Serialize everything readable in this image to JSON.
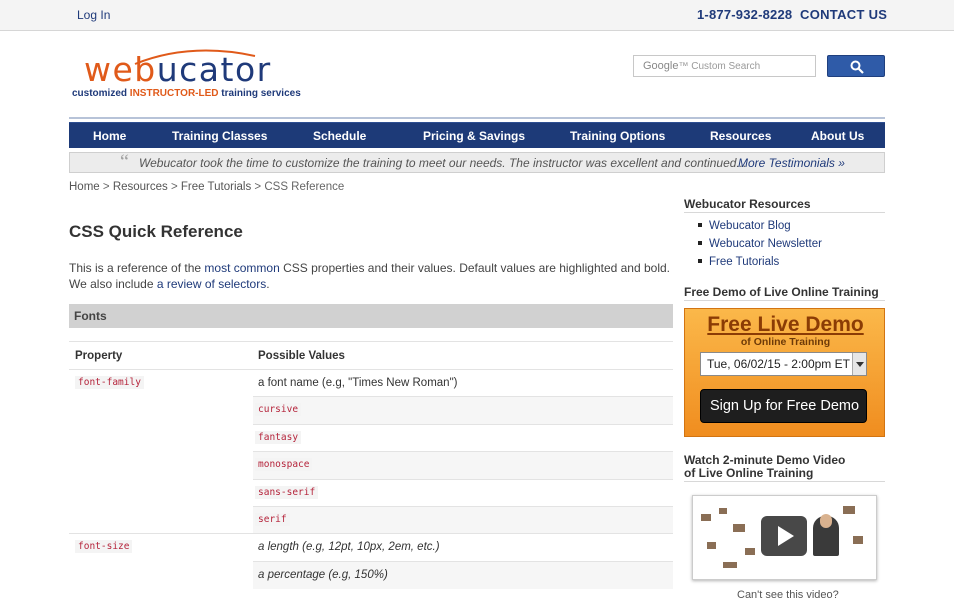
{
  "topbar": {
    "login": "Log In",
    "phone": "1-877-932-8228",
    "contact": "CONTACT US"
  },
  "logo": {
    "word_web": "web",
    "word_ucator": "ucator",
    "tagline_pre": "customized",
    "tagline_ilt": "INSTRUCTOR-LED",
    "tagline_post": "training services"
  },
  "search": {
    "placeholder_brand": "Google",
    "placeholder": "Custom Search"
  },
  "nav": {
    "items": [
      "Home",
      "Training Classes",
      "Schedule",
      "Pricing & Savings",
      "Training Options",
      "Resources",
      "About Us"
    ]
  },
  "testimonial": {
    "quote_mark": "“",
    "text": "Webucator took the time to customize the training to meet our needs. The instructor was excellent and continued...",
    "more": "More Testimonials »"
  },
  "breadcrumb": {
    "home": "Home",
    "sep": ">",
    "resources": "Resources",
    "tutorials": "Free Tutorials",
    "current": "CSS Reference"
  },
  "main": {
    "title": "CSS Quick Reference",
    "intro_1": "This is a reference of the ",
    "intro_link_1": "most common",
    "intro_2": " CSS properties and their values. Default values are highlighted and bold. We also include ",
    "intro_link_2": "a review of selectors",
    "intro_3": ".",
    "section": "Fonts",
    "col_property": "Property",
    "col_values": "Possible Values",
    "rows": [
      {
        "prop": "font-family",
        "value": "a font name (e.g, \"Times New Roman\")",
        "style": "plain"
      },
      {
        "prop": "",
        "value": "cursive",
        "style": "code"
      },
      {
        "prop": "",
        "value": "fantasy",
        "style": "code"
      },
      {
        "prop": "",
        "value": "monospace",
        "style": "code"
      },
      {
        "prop": "",
        "value": "sans-serif",
        "style": "code"
      },
      {
        "prop": "",
        "value": "serif",
        "style": "code"
      },
      {
        "prop": "font-size",
        "value": "a length (e.g, 12pt, 10px, 2em, etc.)",
        "style": "italic"
      },
      {
        "prop": "",
        "value": "a percentage (e.g, 150%)",
        "style": "italic"
      }
    ]
  },
  "sidebar": {
    "resources_heading": "Webucator Resources",
    "links": [
      "Webucator Blog",
      "Webucator Newsletter",
      "Free Tutorials"
    ],
    "demo_heading": "Free Demo of Live Online Training",
    "demo_big": "Free Live Demo",
    "demo_small": "of Online Training",
    "demo_select_value": "Tue, 06/02/15 - 2:00pm ET",
    "demo_button": "Sign Up for Free Demo",
    "video_heading_1": "Watch 2-minute Demo Video",
    "video_heading_2": "of Live Online Training",
    "cant_see": "Can't see this video?"
  },
  "colors": {
    "brand_blue": "#1d3a78",
    "brand_orange": "#e05a1a",
    "code_red": "#b5243b"
  }
}
